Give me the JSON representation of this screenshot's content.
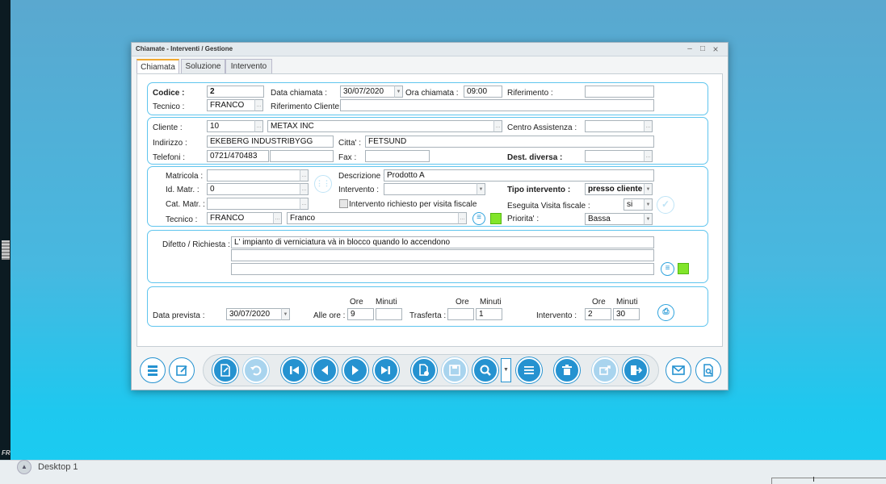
{
  "window": {
    "title": "Chiamate - Interventi / Gestione"
  },
  "tabs": [
    "Chiamata",
    "Soluzione",
    "Intervento"
  ],
  "chiamata": {
    "codice_label": "Codice :",
    "codice": "2",
    "data_label": "Data chiamata :",
    "data": "30/07/2020",
    "ora_label": "Ora chiamata :",
    "ora": "09:00",
    "riferimento_label": "Riferimento :",
    "riferimento": "",
    "tecnico_label": "Tecnico :",
    "tecnico": "FRANCO",
    "rif_cliente_label": "Riferimento Cliente:",
    "rif_cliente": ""
  },
  "cliente": {
    "cliente_label": "Cliente :",
    "codice": "10",
    "nome": "METAX INC",
    "centro_label": "Centro Assistenza :",
    "centro": "",
    "indirizzo_label": "Indirizzo :",
    "indirizzo": "EKEBERG INDUSTRIBYGG",
    "citta_label": "Citta' :",
    "citta": "FETSUND",
    "telefoni_label": "Telefoni :",
    "telefono1": "0721/470483",
    "telefono2": "",
    "fax_label": "Fax :",
    "fax": "",
    "dest_label": "Dest. diversa :",
    "dest": ""
  },
  "macchina": {
    "matricola_label": "Matricola :",
    "matricola": "",
    "idmatr_label": "Id. Matr. :",
    "idmatr": "0",
    "catmatr_label": "Cat. Matr. :",
    "catmatr": "",
    "tecnico_label": "Tecnico :",
    "tecnico_code": "FRANCO",
    "tecnico_name": "Franco",
    "descrizione_label": "Descrizione :",
    "descrizione": "Prodotto A",
    "intervento_label": "Intervento :",
    "intervento": "",
    "visita_check_label": "Intervento richiesto per visita fiscale",
    "tipo_label": "Tipo intervento :",
    "tipo": "presso cliente",
    "eseguita_label": "Eseguita Visita fiscale :",
    "eseguita": "si",
    "priorita_label": "Priorita' :",
    "priorita": "Bassa"
  },
  "difetto": {
    "label": "Difetto / Richiesta :",
    "line1": "L' impianto di verniciatura và in blocco quando lo accendono",
    "line2": "",
    "line3": ""
  },
  "tempi": {
    "data_prevista_label": "Data prevista :",
    "data_prevista": "30/07/2020",
    "alle_ore_label": "Alle ore :",
    "ore_label": "Ore",
    "minuti_label": "Minuti",
    "alle_ore": "9",
    "alle_minuti": "",
    "trasferta_label": "Trasferta :",
    "trasferta_ore": "",
    "trasferta_minuti": "1",
    "intervento_label": "Intervento :",
    "intervento_ore": "2",
    "intervento_minuti": "30"
  },
  "taskbar": {
    "label": "Desktop 1"
  },
  "colors": {
    "accent": "#2592d0",
    "panel_border": "#5fc5ee",
    "green_flag": "#82e52a",
    "active_tab": "#f0a830"
  }
}
